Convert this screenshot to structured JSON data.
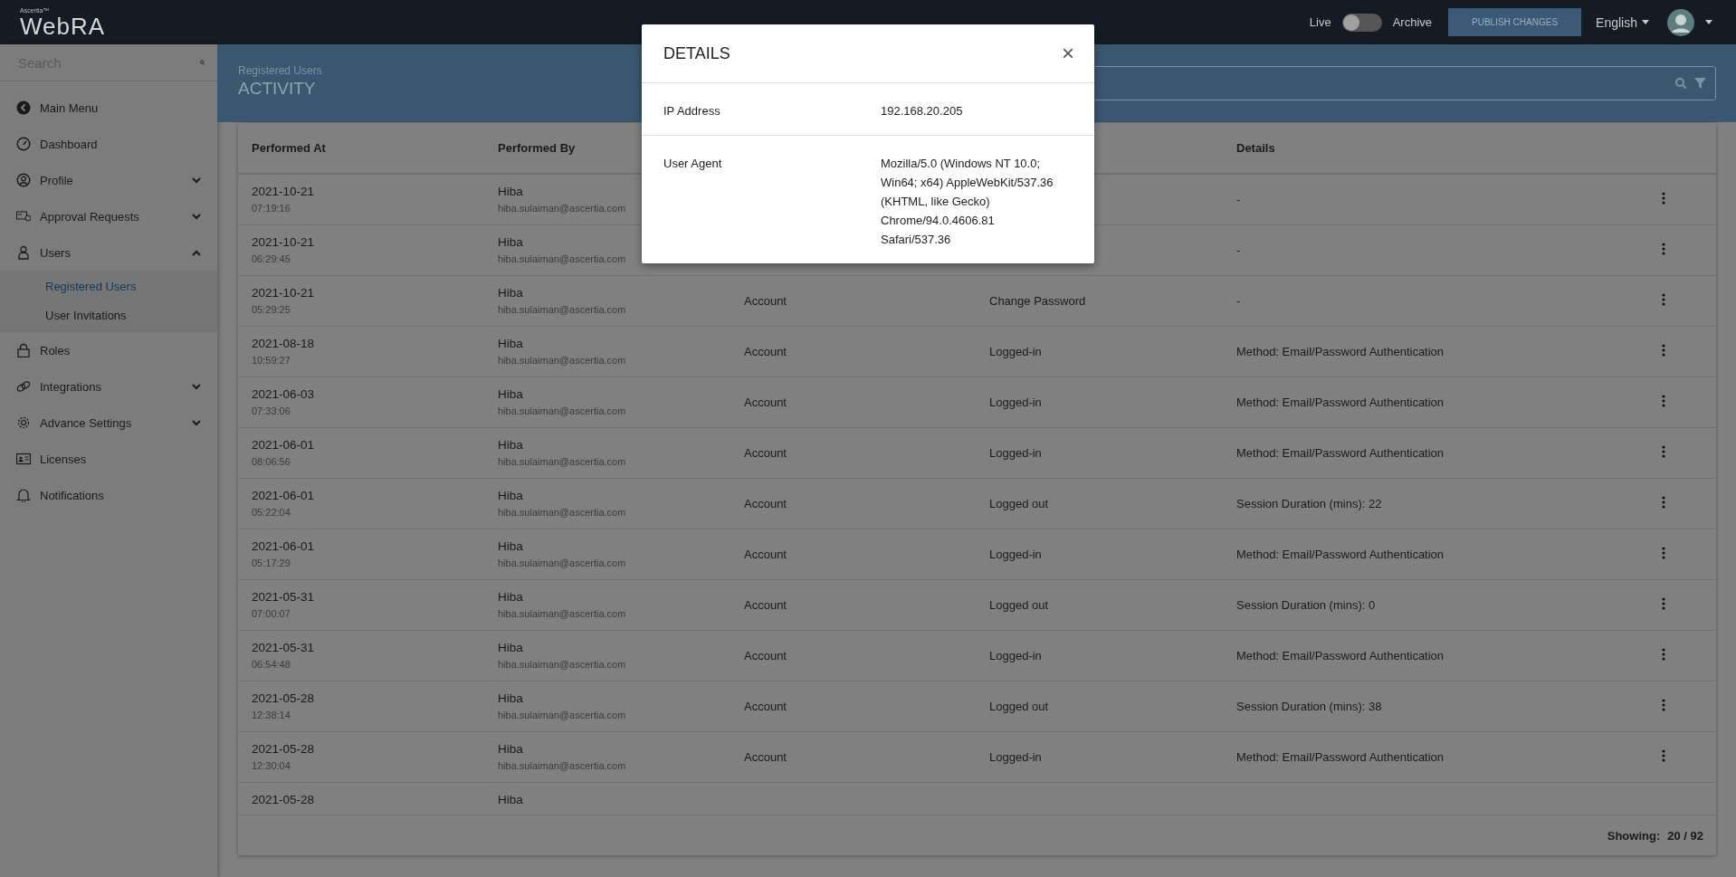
{
  "topbar": {
    "brand_small": "Ascertia™",
    "brand": "WebRA",
    "live_label": "Live",
    "toggle": {
      "on": false
    },
    "archive_label": "Archive",
    "publish_button": "PUBLISH CHANGES",
    "language": "English"
  },
  "sidebar": {
    "search": {
      "placeholder": "Search"
    },
    "items": [
      {
        "label": "Main Menu",
        "kind": "plain"
      },
      {
        "label": "Dashboard",
        "kind": "plain"
      },
      {
        "label": "Profile",
        "kind": "group",
        "expanded": false
      },
      {
        "label": "Approval Requests",
        "kind": "group",
        "expanded": false
      },
      {
        "label": "Users",
        "kind": "group",
        "expanded": true,
        "children": [
          {
            "label": "Registered Users",
            "selected": true
          },
          {
            "label": "User Invitations",
            "selected": false
          }
        ]
      },
      {
        "label": "Roles",
        "kind": "plain"
      },
      {
        "label": "Integrations",
        "kind": "group",
        "expanded": false
      },
      {
        "label": "Advance Settings",
        "kind": "group",
        "expanded": false
      },
      {
        "label": "Licenses",
        "kind": "plain"
      },
      {
        "label": "Notifications",
        "kind": "plain"
      }
    ]
  },
  "header": {
    "breadcrumb": "Registered Users",
    "title": "ACTIVITY"
  },
  "table": {
    "columns": [
      {
        "label": "Performed At"
      },
      {
        "label": "Performed By"
      },
      {},
      {},
      {
        "label": "Details"
      }
    ],
    "rows": [
      {
        "date": "2021-10-21",
        "time": "07:19:16",
        "name": "Hiba",
        "email": "hiba.sulaiman@ascertia.com",
        "details": "-"
      },
      {
        "date": "2021-10-21",
        "time": "06:29:45",
        "name": "Hiba",
        "email": "hiba.sulaiman@ascertia.com",
        "details": "-"
      },
      {
        "date": "2021-10-21",
        "time": "05:29:25",
        "name": "Hiba",
        "email": "hiba.sulaiman@ascertia.com",
        "category": "Account",
        "action": "Change Password",
        "details": "-"
      },
      {
        "date": "2021-08-18",
        "time": "10:59:27",
        "name": "Hiba",
        "email": "hiba.sulaiman@ascertia.com",
        "category": "Account",
        "action": "Logged-in",
        "details": "Method: Email/Password Authentication"
      },
      {
        "date": "2021-06-03",
        "time": "07:33:06",
        "name": "Hiba",
        "email": "hiba.sulaiman@ascertia.com",
        "category": "Account",
        "action": "Logged-in",
        "details": "Method: Email/Password Authentication"
      },
      {
        "date": "2021-06-01",
        "time": "08:06:56",
        "name": "Hiba",
        "email": "hiba.sulaiman@ascertia.com",
        "category": "Account",
        "action": "Logged-in",
        "details": "Method: Email/Password Authentication"
      },
      {
        "date": "2021-06-01",
        "time": "05:22:04",
        "name": "Hiba",
        "email": "hiba.sulaiman@ascertia.com",
        "category": "Account",
        "action": "Logged out",
        "details": "Session Duration (mins): 22"
      },
      {
        "date": "2021-06-01",
        "time": "05:17:29",
        "name": "Hiba",
        "email": "hiba.sulaiman@ascertia.com",
        "category": "Account",
        "action": "Logged-in",
        "details": "Method: Email/Password Authentication"
      },
      {
        "date": "2021-05-31",
        "time": "07:00:07",
        "name": "Hiba",
        "email": "hiba.sulaiman@ascertia.com",
        "category": "Account",
        "action": "Logged out",
        "details": "Session Duration (mins): 0"
      },
      {
        "date": "2021-05-31",
        "time": "06:54:48",
        "name": "Hiba",
        "email": "hiba.sulaiman@ascertia.com",
        "category": "Account",
        "action": "Logged-in",
        "details": "Method: Email/Password Authentication"
      },
      {
        "date": "2021-05-28",
        "time": "12:38:14",
        "name": "Hiba",
        "email": "hiba.sulaiman@ascertia.com",
        "category": "Account",
        "action": "Logged out",
        "details": "Session Duration (mins): 38"
      },
      {
        "date": "2021-05-28",
        "time": "12:30:04",
        "name": "Hiba",
        "email": "hiba.sulaiman@ascertia.com",
        "category": "Account",
        "action": "Logged-in",
        "details": "Method: Email/Password Authentication"
      },
      {
        "date": "2021-05-28",
        "name": "Hiba"
      }
    ],
    "showing_label": "Showing:",
    "showing_value": "20 / 92"
  },
  "modal": {
    "title": "DETAILS",
    "close": "×",
    "fields": [
      {
        "label": "IP Address",
        "value": "192.168.20.205"
      },
      {
        "label": "User Agent",
        "value": "Mozilla/5.0 (Windows NT 10.0; Win64; x64) AppleWebKit/537.36 (KHTML, like Gecko) Chrome/94.0.4606.81 Safari/537.36"
      }
    ]
  }
}
